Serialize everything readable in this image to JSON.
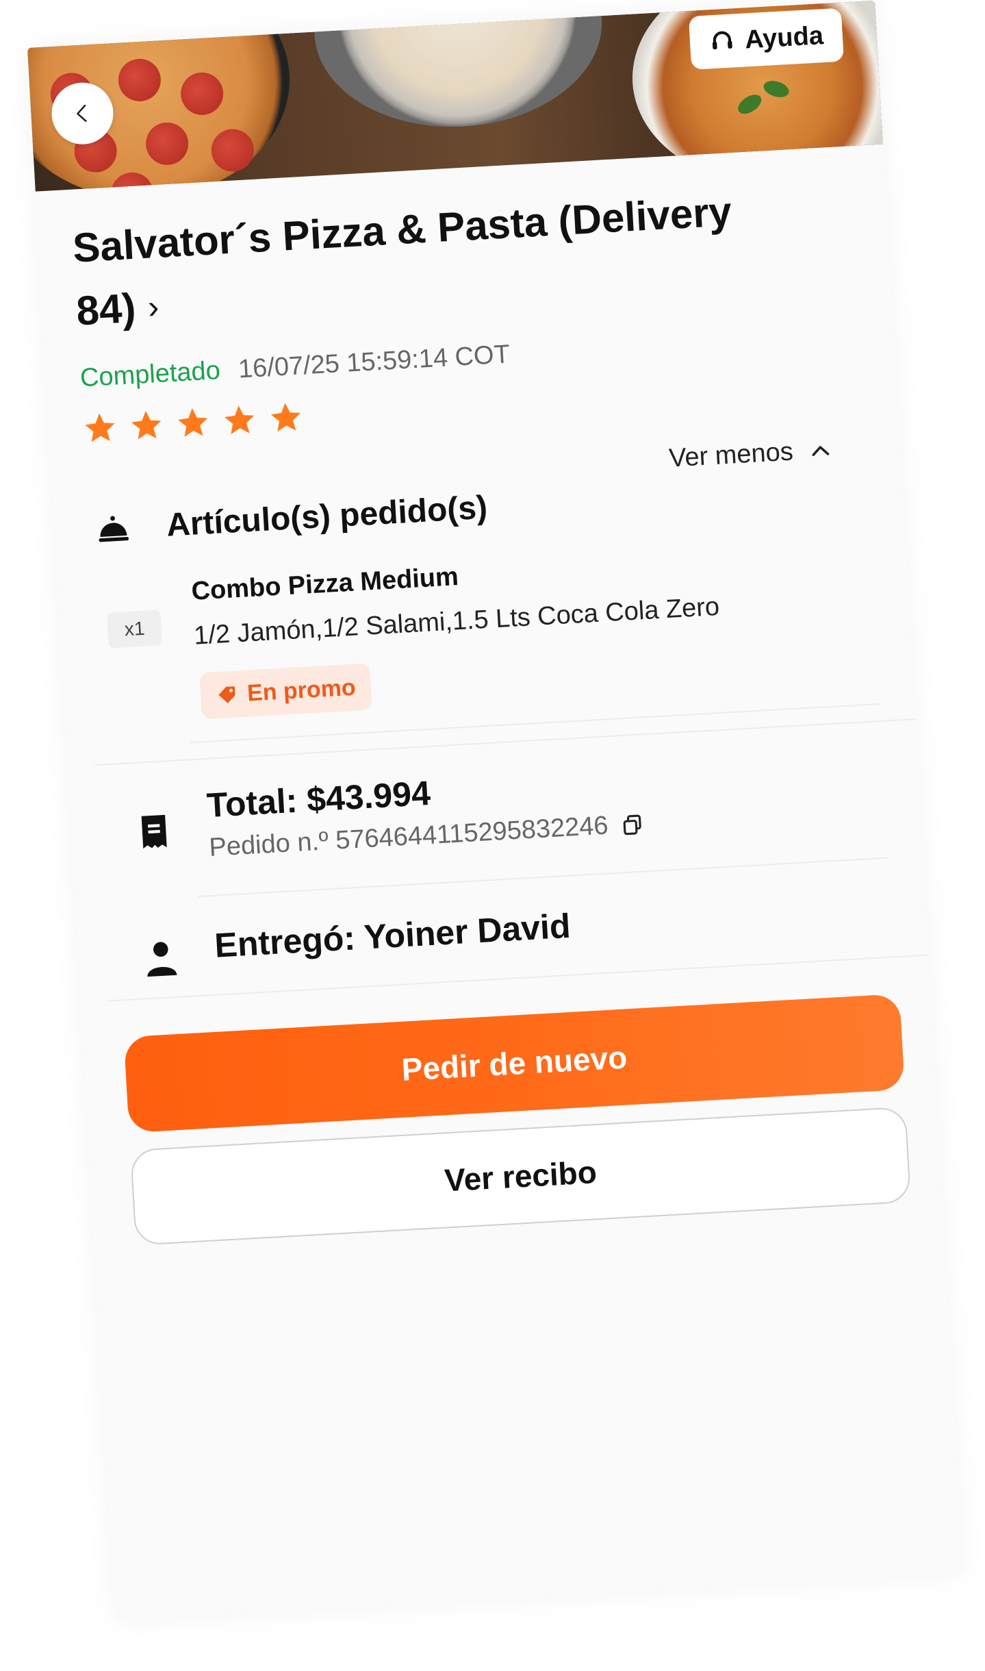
{
  "header": {
    "help_label": "Ayuda"
  },
  "restaurant": {
    "name": "Salvator´s Pizza & Pasta (Delivery 84)",
    "chevron": "›"
  },
  "order": {
    "status": "Completado",
    "timestamp": "16/07/25 15:59:14 COT",
    "rating": 5,
    "status_color": "#1aa34a"
  },
  "items_section": {
    "title": "Artículo(s) pedido(s)",
    "toggle_label": "Ver menos",
    "items": [
      {
        "quantity": "x1",
        "name": "Combo Pizza Medium",
        "description": "1/2 Jamón,1/2 Salami,1.5 Lts Coca Cola Zero",
        "badge": "En promo"
      }
    ]
  },
  "summary": {
    "total": "Total: $43.994",
    "order_number": "Pedido n.º 576464411529583224​6"
  },
  "delivery": {
    "courier": "Entregó: Yoiner David"
  },
  "actions": {
    "reorder_label": "Pedir de nuevo",
    "receipt_label": "Ver recibo"
  },
  "colors": {
    "accent": "#ff6a18",
    "promo_text": "#f05a1a",
    "promo_bg": "#fde9df",
    "star": "#ff7a1a"
  },
  "icons": {
    "back": "chevron-left-icon",
    "help": "headset-icon",
    "section": "food-cloche-icon",
    "toggle": "chevron-up-icon",
    "promo": "tag-icon",
    "receipt": "receipt-icon",
    "copy": "copy-icon",
    "courier": "person-icon"
  }
}
